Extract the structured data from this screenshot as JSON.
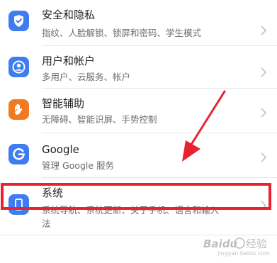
{
  "settings_list": {
    "items": [
      {
        "title": "安全和隐私",
        "subtitle": "指纹、人脸解锁、锁屏和密码、学生模式",
        "icon": "shield-check-icon",
        "icon_color": "#3e7cf0"
      },
      {
        "title": "用户和帐户",
        "subtitle": "多用户、云服务、帐户",
        "icon": "user-account-icon",
        "icon_color": "#3e7cf0"
      },
      {
        "title": "智能辅助",
        "subtitle": "无障碍、智能识屏、手势控制",
        "icon": "hand-icon",
        "icon_color": "#f07b22"
      },
      {
        "title": "Google",
        "subtitle": "管理 Google 服务",
        "icon": "google-g-icon",
        "icon_color": "#3e7cf0"
      },
      {
        "title": "系统",
        "subtitle_line1": "系统导航、系统更新、关于手机、语言和输入",
        "subtitle_line2": "法",
        "icon": "system-phone-icon",
        "icon_color": "#3e7cf0"
      }
    ]
  },
  "annotation": {
    "highlight_color": "#e8232f",
    "arrow_color": "#e8232f"
  },
  "watermark": {
    "brand": "Baidu",
    "text": "经验",
    "url": "jingyan.baidu.com"
  }
}
